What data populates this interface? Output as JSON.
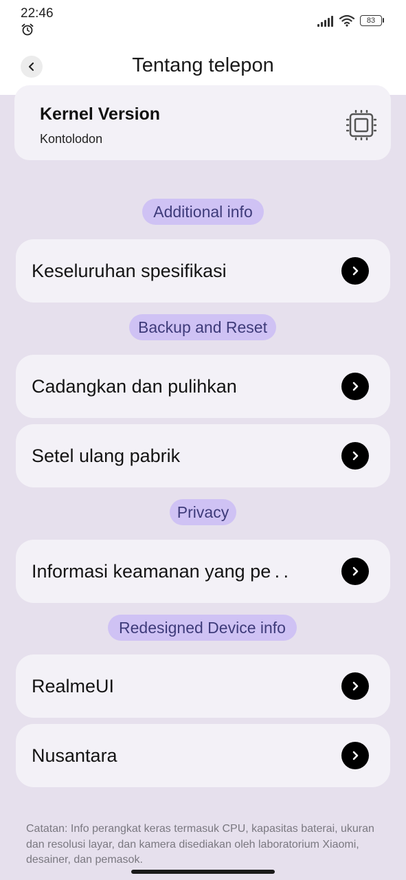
{
  "status_bar": {
    "time": "22:46",
    "battery": "83"
  },
  "header": {
    "title": "Tentang telepon"
  },
  "kernel": {
    "title": "Kernel Version",
    "value": "Kontolodon"
  },
  "sections": {
    "additional": "Additional info",
    "backup": "Backup and Reset",
    "privacy": "Privacy",
    "redesigned": "Redesigned Device info"
  },
  "items": {
    "specs": "Keseluruhan spesifikasi",
    "backup_restore": "Cadangkan dan pulihkan",
    "factory_reset": "Setel ulang pabrik",
    "security_info": "Informasi keamanan yang pe . .",
    "realmeui": "RealmeUI",
    "nusantara": "Nusantara"
  },
  "footnote": "Catatan: Info perangkat keras termasuk CPU, kapasitas baterai, ukuran dan resolusi layar, dan kamera disediakan oleh laboratorium Xiaomi, desainer, dan pemasok."
}
